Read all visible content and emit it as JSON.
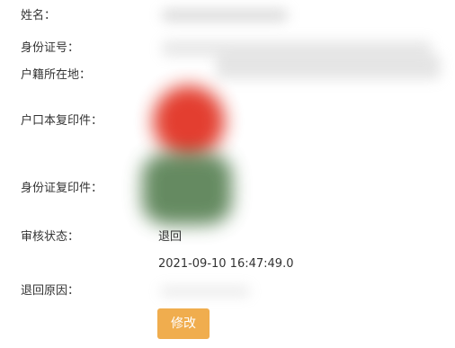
{
  "form": {
    "name_label": "姓名：",
    "id_number_label": "身份证号：",
    "household_location_label": "户籍所在地：",
    "household_copy_label": "户口本复印件：",
    "id_copy_label": "身份证复印件：",
    "review_status_label": "审核状态：",
    "review_status_value": "退回",
    "review_time": "2021-09-10 16:47:49.0",
    "return_reason_label": "退回原因：",
    "modify_button": "修改"
  },
  "colors": {
    "button_bg": "#f0ad4e",
    "blur_red": "#e0301e",
    "blur_green": "#3f6e3a",
    "blur_gray": "#bfbfbf"
  }
}
